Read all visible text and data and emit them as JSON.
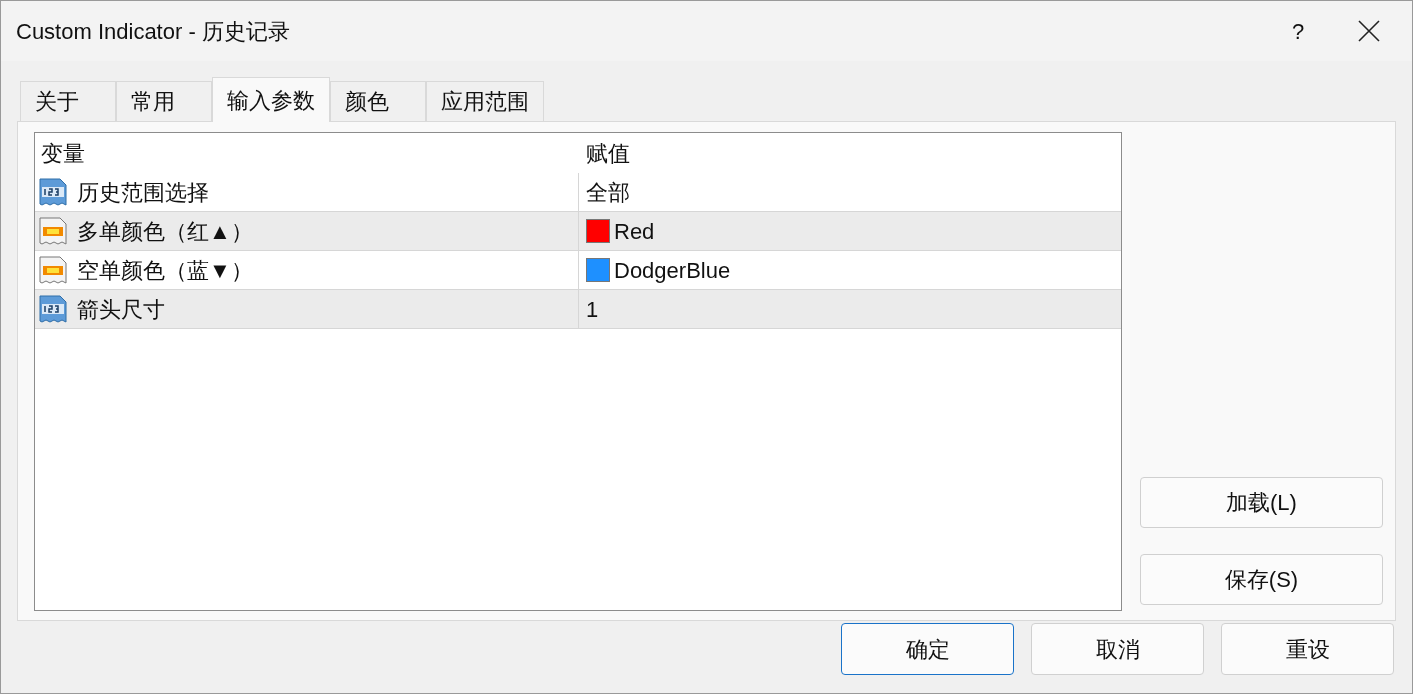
{
  "window": {
    "title": "Custom Indicator - 历史记录",
    "help": "?"
  },
  "tabs": [
    {
      "label": "关于",
      "selected": false
    },
    {
      "label": "常用",
      "selected": false
    },
    {
      "label": "输入参数",
      "selected": true
    },
    {
      "label": "颜色",
      "selected": false
    },
    {
      "label": "应用范围",
      "selected": false
    }
  ],
  "table": {
    "columns": [
      "变量",
      "赋值"
    ],
    "rows": [
      {
        "kind": "number",
        "variable": "历史范围选择",
        "value": "全部"
      },
      {
        "kind": "color",
        "variable": "多单颜色（红▲）",
        "value": "Red",
        "color": "#ff0000"
      },
      {
        "kind": "color",
        "variable": "空单颜色（蓝▼）",
        "value": "DodgerBlue",
        "color": "#1e90ff"
      },
      {
        "kind": "number",
        "variable": "箭头尺寸",
        "value": "1"
      }
    ]
  },
  "side_buttons": [
    "加载(L)",
    "保存(S)"
  ],
  "buttons": [
    {
      "label": "确定",
      "default": true
    },
    {
      "label": "取消",
      "default": false
    },
    {
      "label": "重设",
      "default": false
    }
  ]
}
